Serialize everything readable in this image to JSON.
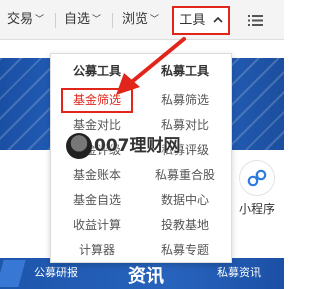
{
  "nav": {
    "items": [
      {
        "label": "交易",
        "has_dropdown": true
      },
      {
        "label": "自选",
        "has_dropdown": true
      },
      {
        "label": "浏览",
        "has_dropdown": true
      }
    ],
    "tools_label": "工具",
    "tools_icon": "chevron-up-icon",
    "list_icon": "list-icon"
  },
  "dropdown": {
    "public_fund": {
      "heading": "公募工具",
      "items": [
        "基金筛选",
        "基金对比",
        "基金评级",
        "基金账本",
        "基金自选",
        "收益计算",
        "计算器"
      ],
      "selected": "基金筛选"
    },
    "private_fund": {
      "heading": "私募工具",
      "items": [
        "私募筛选",
        "私募对比",
        "私募评级",
        "私募重合股",
        "数据中心",
        "投教基地",
        "私募专题"
      ]
    }
  },
  "mini_program": {
    "label": "小程序",
    "icon": "mini-program-icon"
  },
  "footer": {
    "left_text": "公募研报",
    "center_text": "资讯",
    "right_text": "私募资讯"
  },
  "watermark": {
    "text": "007理财网"
  },
  "colors": {
    "highlight": "#e1251b",
    "banner_blue": "#2d6fd0"
  }
}
